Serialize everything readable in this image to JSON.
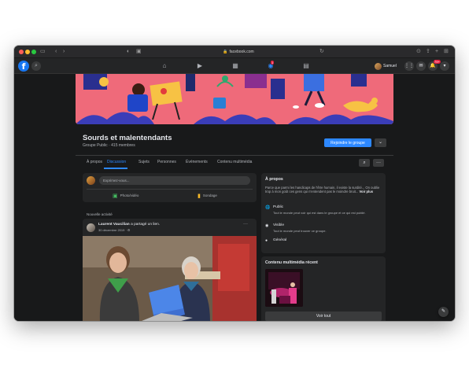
{
  "browser": {
    "url": "facebook.com",
    "colors": {
      "close": "#fe5f57",
      "minimize": "#febc2e",
      "maximize": "#28c840"
    }
  },
  "fb": {
    "logo_letter": "f",
    "notification_badge": "1",
    "alerts_badge": "79+",
    "user_name": "Samuel"
  },
  "group": {
    "name": "Sourds et malentendants",
    "meta": "Groupe Public · 415 membres",
    "join_label": "Rejoindre le groupe",
    "more_label": "⌄"
  },
  "tabs": [
    "À propos",
    "Discussion",
    "Sujets",
    "Personnes",
    "Événements",
    "Contenu multimédia"
  ],
  "composer": {
    "placeholder": "Exprimez-vous...",
    "photo_label": "Photo/vidéo",
    "poll_label": "Sondage"
  },
  "feed": {
    "section_label": "Nouvelle activité",
    "post": {
      "author": "Laurent Vaucilian",
      "action": "a partagé un lien.",
      "date": "30 décembre 2019 · ⚙"
    }
  },
  "about": {
    "title": "À propos",
    "description": "Parce que parmi les handicaps de l'être humain, il existe la surdité... On oublie trop à mon goût ces gens qui n'entendent pas le moindre bruit...",
    "more_label": "Voir plus",
    "items": [
      {
        "icon": "globe-icon",
        "title": "Public",
        "desc": "Tout le monde peut voir qui est dans le groupe et ce qui est publié."
      },
      {
        "icon": "eye-icon",
        "title": "Visible",
        "desc": "Tout le monde peut trouver ce groupe."
      },
      {
        "icon": "people-icon",
        "title": "Général",
        "desc": ""
      }
    ]
  },
  "media": {
    "title": "Contenu multimédia récent",
    "see_all": "Voir tout"
  },
  "accent": "#2d88ff"
}
